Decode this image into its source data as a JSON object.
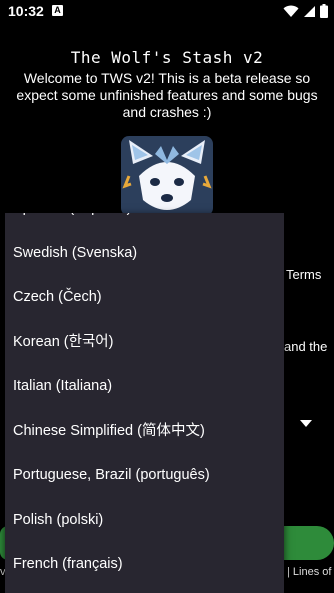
{
  "status_bar": {
    "time": "10:32",
    "app_icon_letter": "A"
  },
  "app": {
    "title": "The Wolf's Stash v2",
    "welcome": "Welcome to TWS v2! This is a beta release so expect some unfinished features and some bugs and crashes :)"
  },
  "background_text": {
    "terms_fragment": "Terms",
    "and_the_fragment": "and the",
    "footer_left": "v",
    "footer_right": "| Lines of"
  },
  "colors": {
    "background": "#000000",
    "dropdown_bg": "#282630",
    "accent_green": "#2e8b3a",
    "logo_bg": "#2c3f5c"
  },
  "language_dropdown": {
    "items": [
      "Spanish (Español)",
      "Swedish (Svenska)",
      "Czech (Čech)",
      "Korean (한국어)",
      "Italian (Italiana)",
      "Chinese Simplified (简体中文)",
      "Portuguese, Brazil (português)",
      "Polish (polski)",
      "French (français)"
    ]
  }
}
